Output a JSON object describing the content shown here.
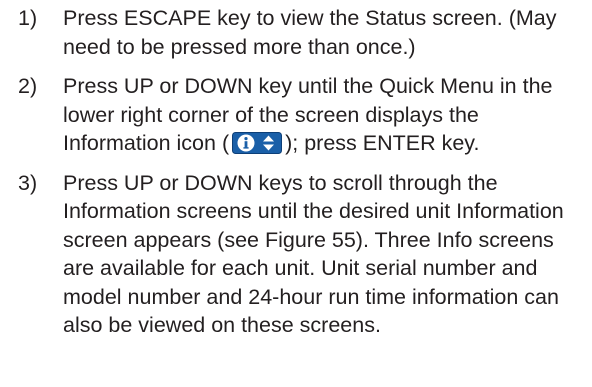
{
  "steps": [
    {
      "number": "1)",
      "text": "Press ESCAPE key to view the Status screen. (May need to be pressed more than once.)"
    },
    {
      "number": "2)",
      "text_before_icon": "Press UP or DOWN key until the Quick Menu in the lower right corner of the screen displays the Information icon (",
      "icon": "information-quick-menu-icon",
      "text_after_icon": "); press ENTER key."
    },
    {
      "number": "3)",
      "text": "Press UP or DOWN keys to scroll through the Information screens until the desired unit Information screen appears (see Figure 55). Three Info screens are available for each unit. Unit serial number and model number and 24-hour run time information can also be viewed on these screens."
    }
  ],
  "colors": {
    "text": "#231f20",
    "icon_background": "#1a5fa8",
    "icon_foreground": "#ffffff"
  }
}
